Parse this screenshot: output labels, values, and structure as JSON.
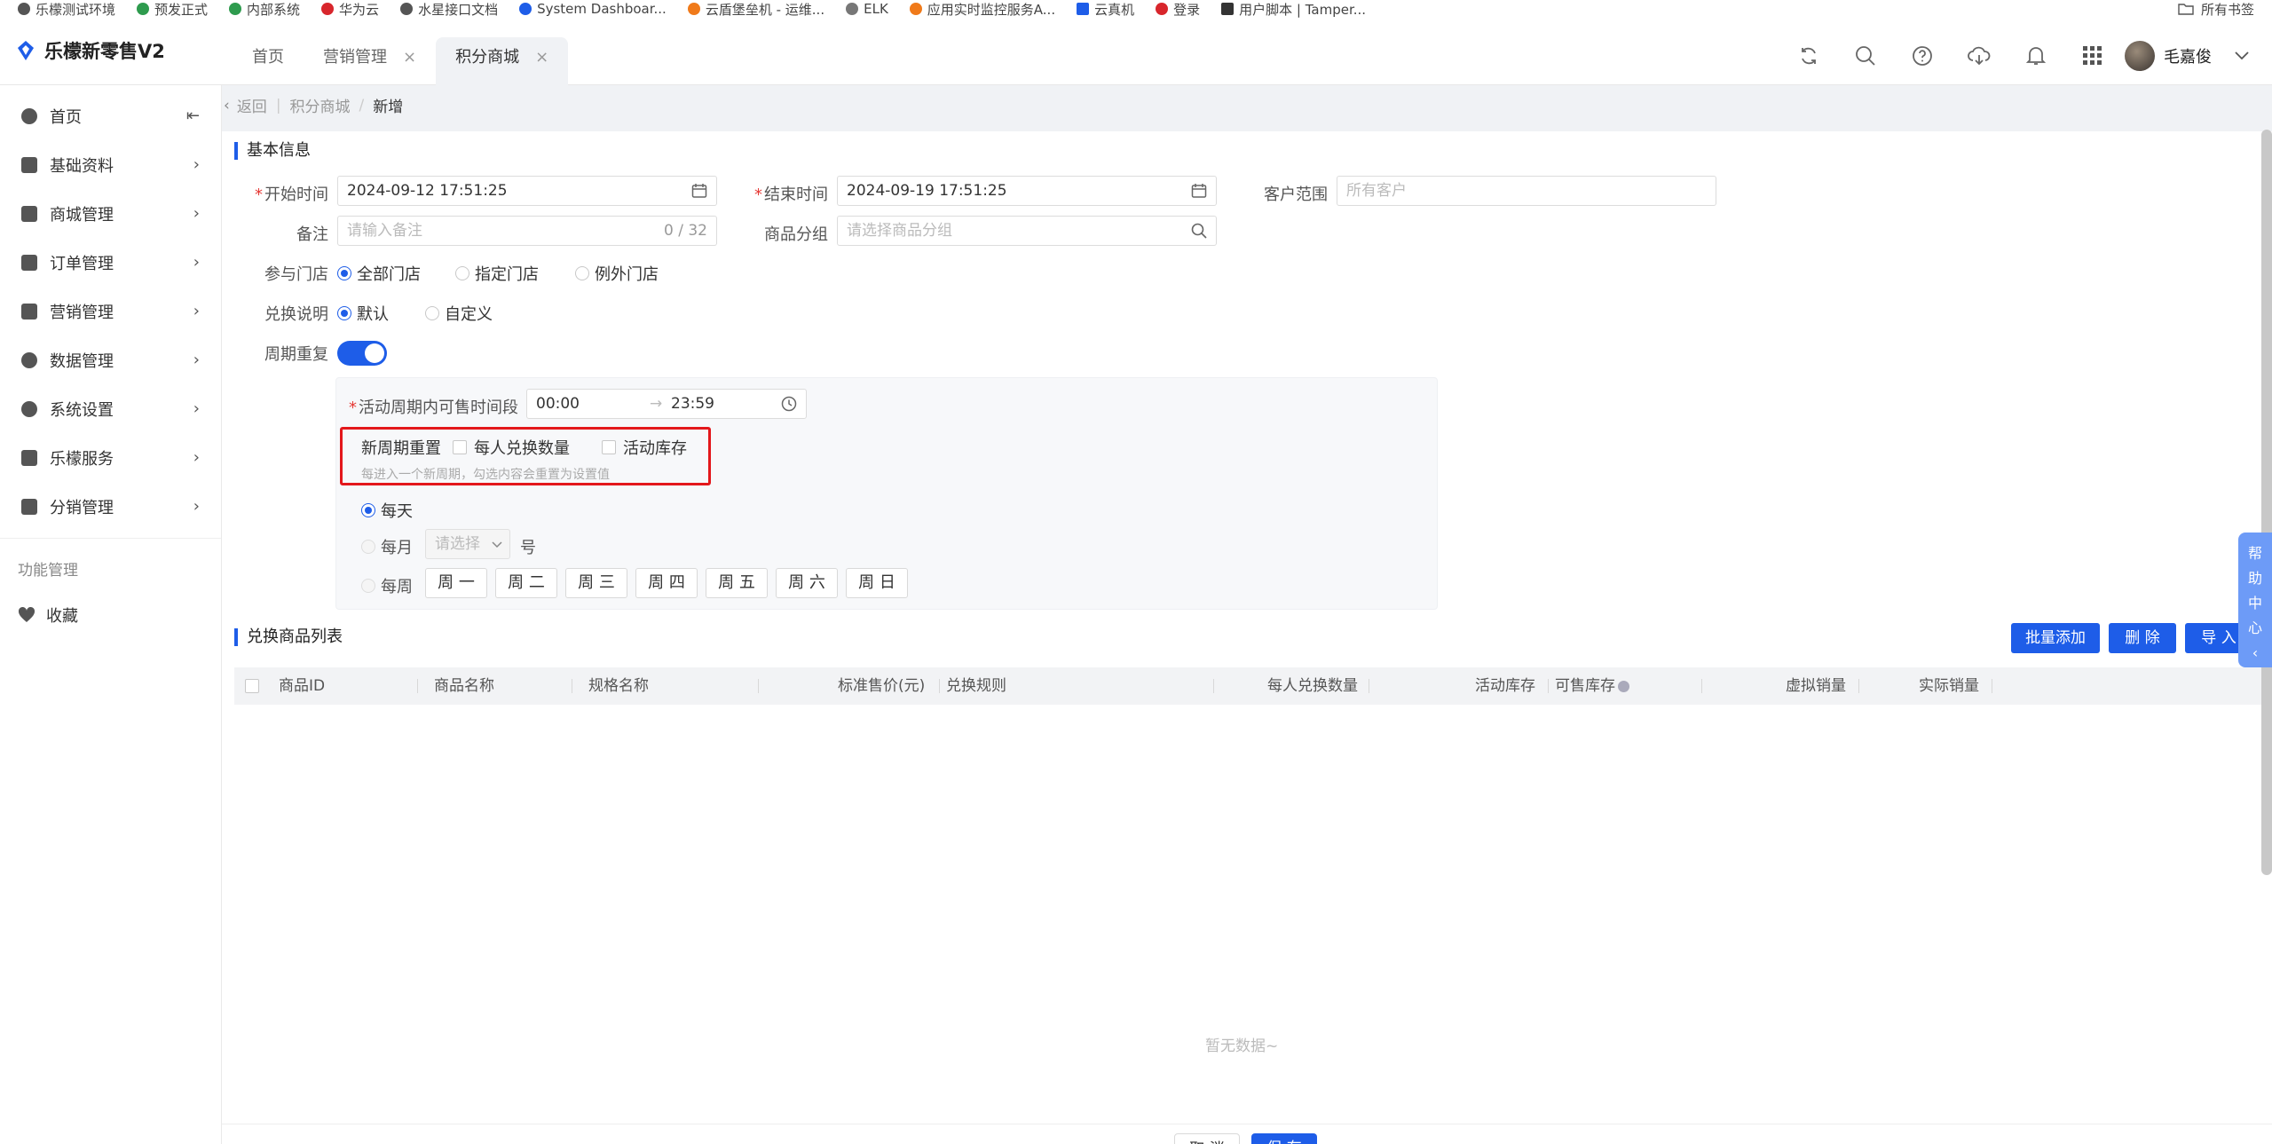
{
  "bookmarks": {
    "items": [
      {
        "label": "乐檬测试环境",
        "color": "#555555"
      },
      {
        "label": "预发正式",
        "color": "#2e9b4e"
      },
      {
        "label": "内部系统",
        "color": "#2e9b4e"
      },
      {
        "label": "华为云",
        "color": "#d8262c"
      },
      {
        "label": "水星接口文档",
        "color": "#555555"
      },
      {
        "label": "System Dashboar...",
        "color": "#1e5de8"
      },
      {
        "label": "云盾堡垒机 - 运维...",
        "color": "#f07a1a"
      },
      {
        "label": "ELK",
        "color": "#777777"
      },
      {
        "label": "应用实时监控服务A...",
        "color": "#f07a1a"
      },
      {
        "label": "云真机",
        "color": "#1e5de8"
      },
      {
        "label": "登录",
        "color": "#d8262c"
      },
      {
        "label": "用户脚本 | Tamper...",
        "color": "#333333"
      }
    ],
    "all_bookmarks": "所有书签"
  },
  "header": {
    "app_title": "乐檬新零售V2",
    "tabs": [
      {
        "label": "首页",
        "closable": false,
        "active": false
      },
      {
        "label": "营销管理",
        "closable": true,
        "active": false
      },
      {
        "label": "积分商城",
        "closable": true,
        "active": true
      }
    ],
    "close_glyph": "×",
    "user_name": "毛嘉俊"
  },
  "sidebar": {
    "items": [
      {
        "label": "首页"
      },
      {
        "label": "基础资料"
      },
      {
        "label": "商城管理"
      },
      {
        "label": "订单管理"
      },
      {
        "label": "营销管理"
      },
      {
        "label": "数据管理"
      },
      {
        "label": "系统设置"
      },
      {
        "label": "乐檬服务"
      },
      {
        "label": "分销管理"
      }
    ],
    "section_label": "功能管理",
    "favorite_label": "收藏"
  },
  "breadcrumb": {
    "back": "返回",
    "parent": "积分商城",
    "separator": "/",
    "current": "新增"
  },
  "basic_info": {
    "title": "基本信息",
    "start_time_label": "开始时间",
    "start_time_value": "2024-09-12 17:51:25",
    "end_time_label": "结束时间",
    "end_time_value": "2024-09-19 17:51:25",
    "customer_scope_label": "客户范围",
    "customer_scope_placeholder": "所有客户",
    "remark_label": "备注",
    "remark_placeholder": "请输入备注",
    "remark_count": "0 / 32",
    "product_group_label": "商品分组",
    "product_group_placeholder": "请选择商品分组",
    "stores_label": "参与门店",
    "stores_options": [
      "全部门店",
      "指定门店",
      "例外门店"
    ],
    "stores_selected": "全部门店",
    "exchange_desc_label": "兑换说明",
    "exchange_desc_options": [
      "默认",
      "自定义"
    ],
    "exchange_desc_selected": "默认",
    "cycle_repeat_label": "周期重复",
    "cycle_repeat_on": true
  },
  "cycle": {
    "time_range_label": "活动周期内可售时间段",
    "time_start": "00:00",
    "time_arrow": "→",
    "time_end": "23:59",
    "reset_label": "新周期重置",
    "reset_options": [
      "每人兑换数量",
      "活动库存"
    ],
    "reset_hint": "每进入一个新周期，勾选内容会重置为设置值",
    "daily_label": "每天",
    "monthly_label": "每月",
    "monthly_placeholder": "请选择",
    "monthly_suffix": "号",
    "weekly_label": "每周",
    "weekdays": [
      "周 一",
      "周 二",
      "周 三",
      "周 四",
      "周 五",
      "周 六",
      "周 日"
    ],
    "selected": "每天"
  },
  "product_list": {
    "title": "兑换商品列表",
    "batch_add": "批量添加",
    "delete": "删 除",
    "import": "导 入",
    "columns": [
      "商品ID",
      "商品名称",
      "规格名称",
      "标准售价(元)",
      "兑换规则",
      "每人兑换数量",
      "活动库存",
      "可售库存",
      "虚拟销量",
      "实际销量"
    ],
    "empty_text": "暂无数据~"
  },
  "help_center": {
    "chars": [
      "帮",
      "助",
      "中",
      "心"
    ],
    "collapse": "‹"
  },
  "footer": {
    "cancel": "取 消",
    "save": "保 存"
  },
  "colors": {
    "primary": "#1e5de8",
    "highlight": "#e3171b"
  }
}
